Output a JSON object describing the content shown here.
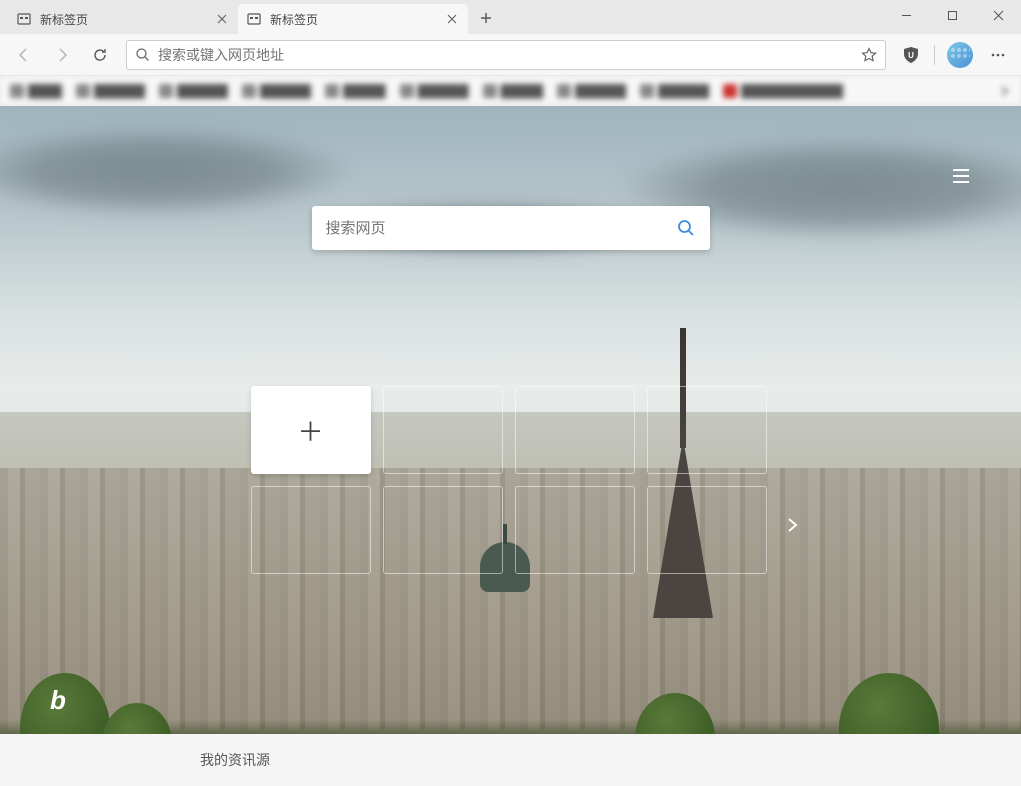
{
  "tabs": [
    {
      "title": "新标签页"
    },
    {
      "title": "新标签页"
    }
  ],
  "addressbar": {
    "placeholder": "搜索或键入网页地址"
  },
  "ntp": {
    "search_placeholder": "搜索网页",
    "feed_label": "我的资讯源",
    "bing_label": "b"
  }
}
